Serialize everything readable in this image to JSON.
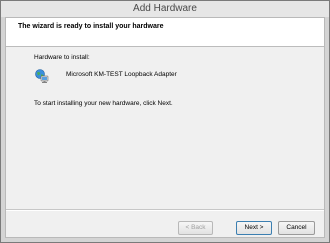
{
  "window": {
    "title": "Add Hardware"
  },
  "header": {
    "text": "The wizard is ready to install your hardware"
  },
  "content": {
    "hardware_label": "Hardware to install:",
    "device_icon": "network-adapter-icon",
    "device_name": "Microsoft KM-TEST Loopback Adapter",
    "instruction": "To start installing your new hardware, click Next."
  },
  "buttons": {
    "back": "< Back",
    "next": "Next >",
    "cancel": "Cancel"
  }
}
